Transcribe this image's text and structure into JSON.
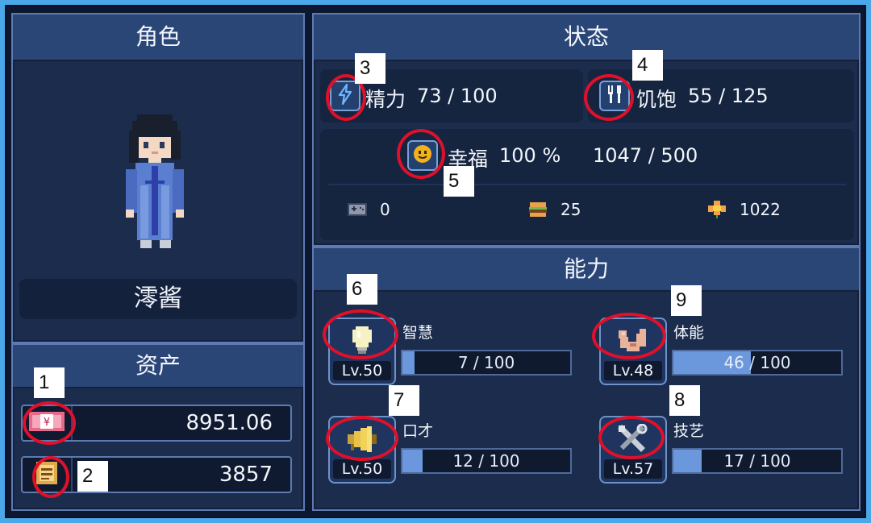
{
  "character": {
    "title": "角色",
    "name": "澪酱"
  },
  "assets": {
    "title": "资产",
    "money": "8951.06",
    "tickets": "3857"
  },
  "status": {
    "title": "状态",
    "energy_label": "精力",
    "energy_value": "73 / 100",
    "hunger_label": "饥饱",
    "hunger_value": "55 / 125",
    "happiness_label": "幸福",
    "happiness_percent": "100 %",
    "happiness_value": "1047 / 500",
    "counters": [
      {
        "icon": "gamepad-icon",
        "value": "0"
      },
      {
        "icon": "burger-icon",
        "value": "25"
      },
      {
        "icon": "flower-icon",
        "value": "1022"
      }
    ]
  },
  "abilities": {
    "title": "能力",
    "items": [
      {
        "name": "智慧",
        "level": "Lv.50",
        "value": "7 / 100",
        "fraction": 0.07,
        "icon": "lightbulb-icon"
      },
      {
        "name": "体能",
        "level": "Lv.48",
        "value": "46 / 100",
        "fraction": 0.46,
        "icon": "muscle-arm-icon"
      },
      {
        "name": "口才",
        "level": "Lv.50",
        "value": "12 / 100",
        "fraction": 0.12,
        "icon": "megaphone-icon"
      },
      {
        "name": "技艺",
        "level": "Lv.57",
        "value": "17 / 100",
        "fraction": 0.17,
        "icon": "tools-icon"
      }
    ]
  },
  "annotations": [
    "1",
    "2",
    "3",
    "4",
    "5",
    "6",
    "7",
    "8",
    "9"
  ],
  "colors": {
    "panel_bg": "#1b2c4d",
    "header_bg": "#2a4677",
    "bar_fill": "#6b98dd",
    "annotation_ring": "#e0102a",
    "outer_bg": "#4aa8e8"
  }
}
